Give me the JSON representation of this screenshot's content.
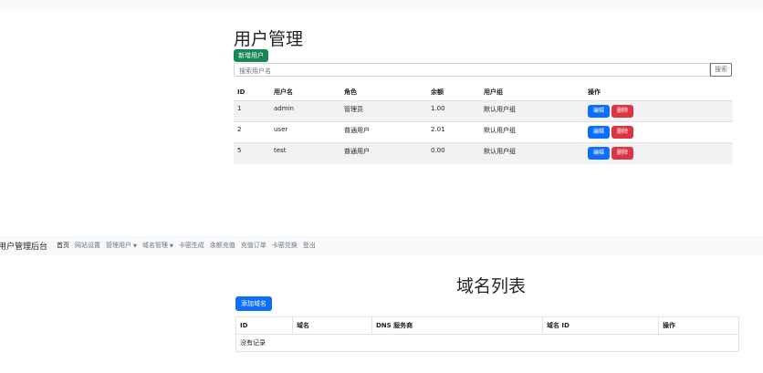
{
  "user_page": {
    "title": "用户管理",
    "add_button": "新增用户",
    "search": {
      "placeholder": "搜索用户名",
      "button": "搜索"
    },
    "columns": [
      "ID",
      "用户名",
      "角色",
      "余额",
      "用户组",
      "操作"
    ],
    "rows": [
      {
        "id": "1",
        "username": "admin",
        "role": "管理员",
        "balance": "1.00",
        "group": "默认用户组"
      },
      {
        "id": "2",
        "username": "user",
        "role": "普通用户",
        "balance": "2.01",
        "group": "默认用户组"
      },
      {
        "id": "5",
        "username": "test",
        "role": "普通用户",
        "balance": "0.00",
        "group": "默认用户组"
      }
    ],
    "actions": {
      "edit": "编辑",
      "delete": "删除"
    }
  },
  "navbar": {
    "brand": "用户管理后台",
    "items": [
      "首页",
      "网站设置",
      "管理用户",
      "域名管理",
      "卡密生成",
      "余额充值",
      "充值订单",
      "卡密兑换",
      "登出"
    ]
  },
  "domain_page": {
    "title": "域名列表",
    "add_button": "添加域名",
    "columns": [
      "ID",
      "域名",
      "DNS 服务商",
      "域名 ID",
      "操作"
    ],
    "empty_text": "没有记录"
  }
}
